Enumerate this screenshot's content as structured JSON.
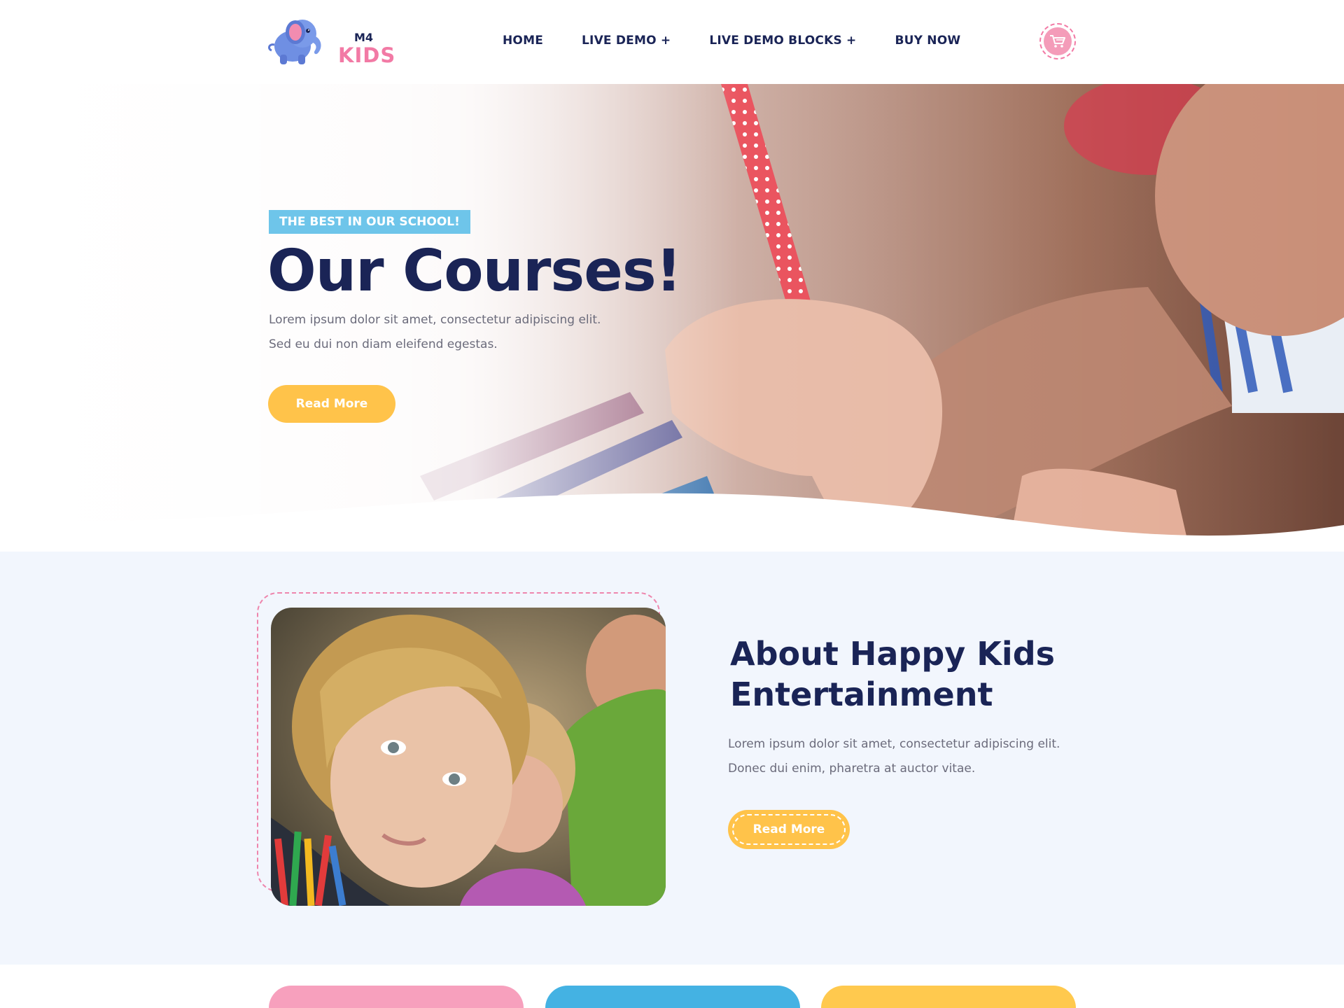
{
  "brand": {
    "top": "M4",
    "name": "KIDS",
    "mascot_icon": "elephant-icon",
    "colors": {
      "navy": "#1a2456",
      "pink": "#f27aa5",
      "yellow": "#ffc34a",
      "blue": "#6ec5ea",
      "light_bg": "#f2f6fd"
    }
  },
  "nav": {
    "items": [
      {
        "label": "HOME"
      },
      {
        "label": "LIVE DEMO +"
      },
      {
        "label": "LIVE DEMO BLOCKS +"
      },
      {
        "label": "BUY NOW"
      }
    ],
    "cart_icon": "shopping-cart-icon"
  },
  "hero": {
    "badge": "THE BEST IN OUR SCHOOL!",
    "title": "Our Courses!",
    "text_line1": "Lorem ipsum dolor sit amet, consectetur adipiscing elit.",
    "text_line2": "Sed eu dui non diam eleifend egestas.",
    "button": "Read More",
    "image": "child writing with red polka-dot pencil"
  },
  "about": {
    "title_line1": "About Happy Kids",
    "title_line2": "Entertainment",
    "text": "Lorem ipsum dolor sit amet, consectetur adipiscing elit. Donec dui enim, pharetra at auctor vitae.",
    "button": "Read More",
    "image": "blonde child with colored pencils"
  },
  "cards": [
    {
      "color": "#f7a0bd"
    },
    {
      "color": "#44b2e3"
    },
    {
      "color": "#ffc94e"
    }
  ]
}
